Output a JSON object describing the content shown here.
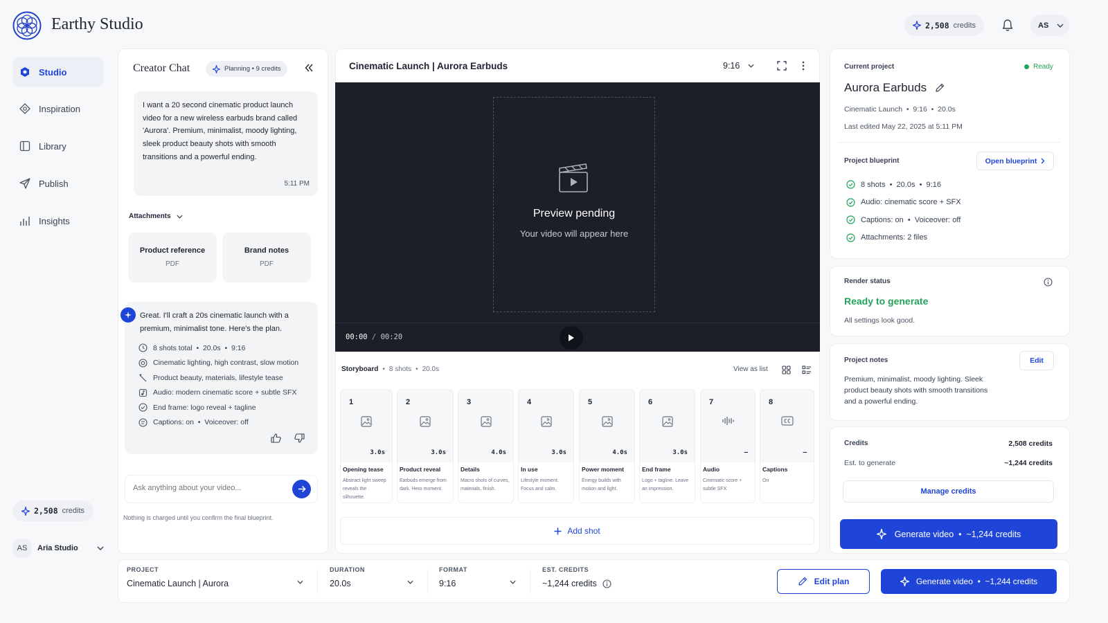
{
  "header": {
    "app_name": "Earthy Studio",
    "credits_value": "2,508",
    "credits_label": "credits",
    "avatar_initials": "AS"
  },
  "sidebar": {
    "items": [
      {
        "label": "Studio",
        "icon": "studio-icon",
        "active": true
      },
      {
        "label": "Inspiration",
        "icon": "inspiration-icon"
      },
      {
        "label": "Library",
        "icon": "library-icon"
      },
      {
        "label": "Publish",
        "icon": "publish-icon"
      },
      {
        "label": "Insights",
        "icon": "insights-icon"
      }
    ],
    "credits_value": "2,508",
    "credits_label": "credits",
    "user_initials": "AS",
    "user_name": "Aria Studio"
  },
  "chat": {
    "title": "Creator Chat",
    "badge": "Planning • 9 credits",
    "user_message": "I want a 20 second cinematic product launch video for a new wireless earbuds brand called 'Aurora'. Premium, minimalist, moody lighting, sleek product beauty shots with smooth transitions and a powerful ending.",
    "user_time": "5:11 PM",
    "attachments_label": "Attachments",
    "attachments": [
      {
        "title": "Product reference",
        "type": "PDF"
      },
      {
        "title": "Brand notes",
        "type": "PDF"
      }
    ],
    "ai_message": "Great. I'll craft a 20s cinematic launch with a premium, minimalist tone. Here's the plan.",
    "plan": [
      {
        "icon": "clock-icon",
        "text": "8 shots total  •  20.0s  •  9:16"
      },
      {
        "icon": "lighting-icon",
        "text": "Cinematic lighting, high contrast, slow motion"
      },
      {
        "icon": "wand-icon",
        "text": "Product beauty, materials, lifestyle tease"
      },
      {
        "icon": "music-icon",
        "text": "Audio: modern cinematic score + subtle SFX"
      },
      {
        "icon": "check-circle-icon",
        "text": "End frame: logo reveal + tagline"
      },
      {
        "icon": "captions-icon",
        "text": "Captions: on  •  Voiceover: off"
      }
    ],
    "input_placeholder": "Ask anything about your video...",
    "footnote": "Nothing is charged until you confirm the final blueprint."
  },
  "preview": {
    "title": "Cinematic Launch | Aurora Earbuds",
    "aspect": "9:16",
    "pending_title": "Preview pending",
    "pending_sub": "Your video will appear here",
    "time_current": "00:00",
    "time_total": "00:20"
  },
  "storyboard": {
    "title": "Storyboard",
    "shots_count": "8 shots",
    "duration": "20.0s",
    "view_as_list": "View as list",
    "shots": [
      {
        "num": "1",
        "duration": "3.0s",
        "name": "Opening tease",
        "desc": "Abstract light sweep reveals the silhouette.",
        "icon": "image-icon"
      },
      {
        "num": "2",
        "duration": "3.0s",
        "name": "Product reveal",
        "desc": "Earbuds emerge from dark. Hero moment.",
        "icon": "image-icon"
      },
      {
        "num": "3",
        "duration": "4.0s",
        "name": "Details",
        "desc": "Macro shots of curves, materials, finish.",
        "icon": "image-icon"
      },
      {
        "num": "4",
        "duration": "3.0s",
        "name": "In use",
        "desc": "Lifestyle moment. Focus and calm.",
        "icon": "image-icon"
      },
      {
        "num": "5",
        "duration": "4.0s",
        "name": "Power moment",
        "desc": "Energy builds with motion and light.",
        "icon": "image-icon"
      },
      {
        "num": "6",
        "duration": "3.0s",
        "name": "End frame",
        "desc": "Logo + tagline. Leave an impression.",
        "icon": "image-icon"
      },
      {
        "num": "7",
        "duration": "–",
        "name": "Audio",
        "desc": "Cinematic score + subtle SFX",
        "icon": "waveform-icon"
      },
      {
        "num": "8",
        "duration": "–",
        "name": "Captions",
        "desc": "On",
        "icon": "cc-icon"
      }
    ],
    "add_shot": "Add shot"
  },
  "project": {
    "section_label": "Current project",
    "status": "Ready",
    "name": "Aurora Earbuds",
    "meta": "Cinematic Launch  •  9:16  •  20.0s",
    "last_edited": "Last edited May 22, 2025 at 5:11 PM",
    "blueprint_label": "Project blueprint",
    "open_blueprint": "Open blueprint",
    "blueprint_items": [
      "8 shots  •  20.0s  •  9:16",
      "Audio: cinematic score + SFX",
      "Captions: on  •  Voiceover: off",
      "Attachments: 2 files"
    ]
  },
  "render": {
    "label": "Render status",
    "status": "Ready to generate",
    "sub": "All settings look good."
  },
  "notes": {
    "label": "Project notes",
    "edit": "Edit",
    "text": "Premium, minimalist, moody lighting. Sleek product beauty shots with smooth transitions and a powerful ending."
  },
  "credits_panel": {
    "label": "Credits",
    "value": "2,508 credits",
    "est_label": "Est. to generate",
    "est_value": "~1,244 credits",
    "manage": "Manage credits",
    "generate": "Generate video  •  ~1,244 credits"
  },
  "bottom_bar": {
    "project_key": "PROJECT",
    "project_value": "Cinematic Launch | Aurora",
    "duration_key": "DURATION",
    "duration_value": "20.0s",
    "format_key": "FORMAT",
    "format_value": "9:16",
    "credits_key": "EST. CREDITS",
    "credits_value": "~1,244 credits",
    "edit_plan": "Edit plan",
    "generate": "Generate video  •  ~1,244 credits"
  },
  "colors": {
    "accent": "#1e44d8",
    "success": "#22a35a",
    "video_bg": "#1c1f27"
  }
}
